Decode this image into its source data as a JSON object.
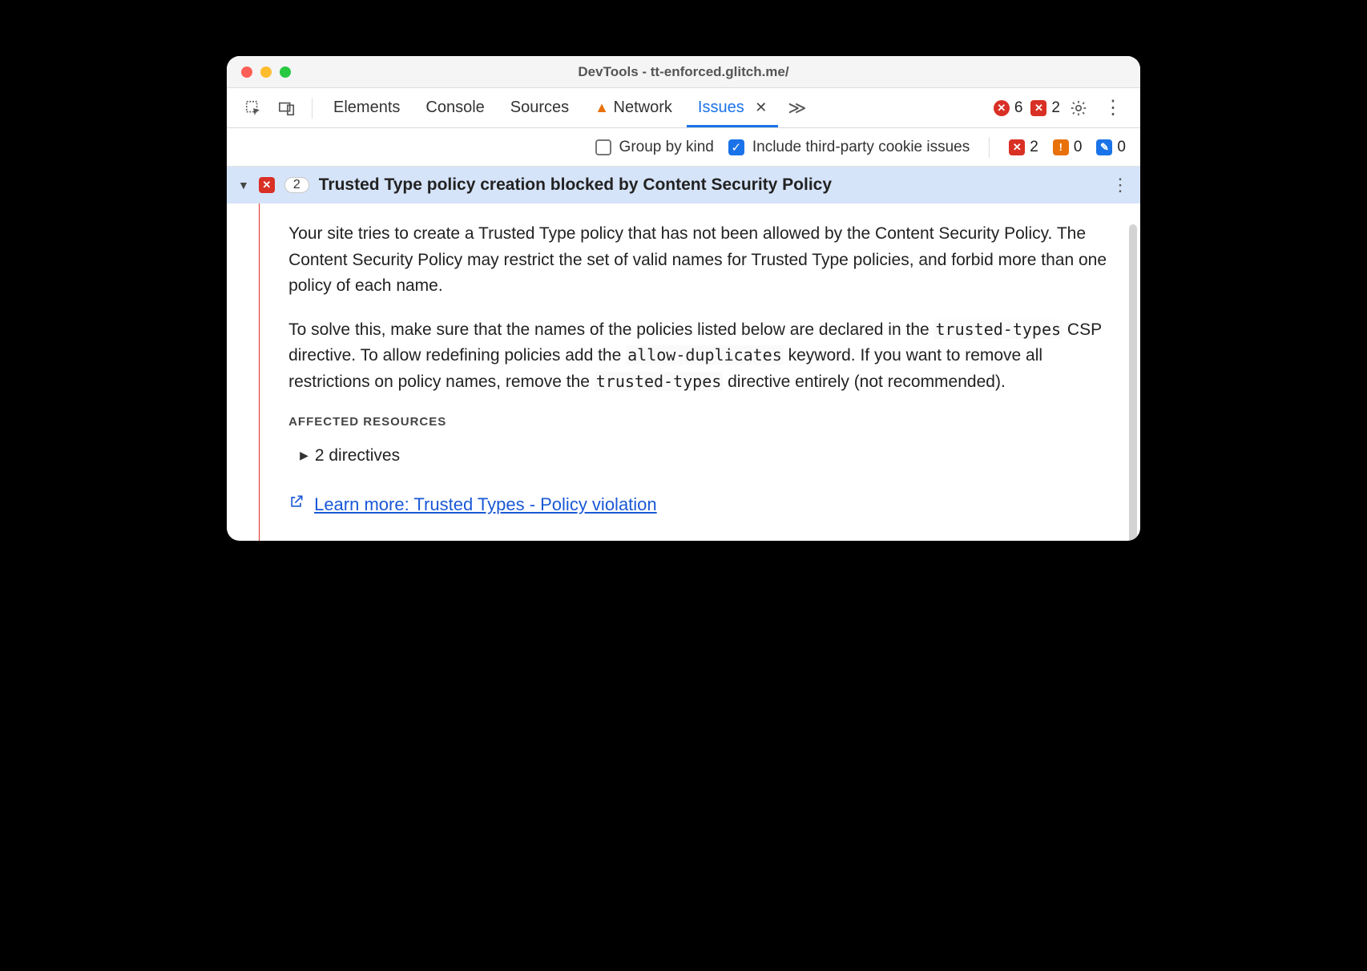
{
  "window": {
    "title": "DevTools - tt-enforced.glitch.me/"
  },
  "tabs": {
    "elements": "Elements",
    "console": "Console",
    "sources": "Sources",
    "network": "Network",
    "issues": "Issues"
  },
  "topcounts": {
    "errors": "6",
    "page_errors": "2"
  },
  "filters": {
    "group_by_kind": "Group by kind",
    "third_party": "Include third-party cookie issues",
    "counts": {
      "page_errors": "2",
      "breaking": "0",
      "improvements": "0"
    }
  },
  "issue": {
    "count": "2",
    "title": "Trusted Type policy creation blocked by Content Security Policy",
    "p1a": "Your site tries to create a Trusted Type policy that has not been allowed by the Content Security Policy. The Content Security Policy may restrict the set of valid names for Trusted Type policies, and forbid more than one policy of each name.",
    "p2_a": "To solve this, make sure that the names of the policies listed below are declared in the ",
    "p2_code1": "trusted-types",
    "p2_b": " CSP directive. To allow redefining policies add the ",
    "p2_code2": "allow-duplicates",
    "p2_c": " keyword. If you want to remove all restrictions on policy names, remove the ",
    "p2_code3": "trusted-types",
    "p2_d": " directive entirely (not recommended).",
    "affected_label": "AFFECTED RESOURCES",
    "directives": "2 directives",
    "learn_more": "Learn more: Trusted Types - Policy violation"
  }
}
